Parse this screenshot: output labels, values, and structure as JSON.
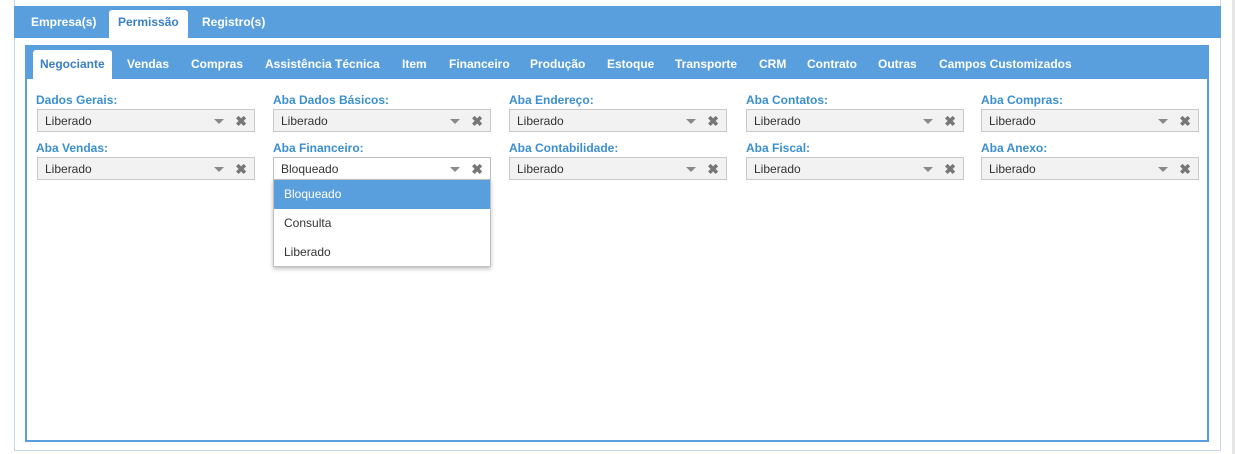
{
  "outer_tabs": [
    "Empresa(s)",
    "Permissão",
    "Registro(s)"
  ],
  "inner_tabs": [
    "Negociante",
    "Vendas",
    "Compras",
    "Assistência Técnica",
    "Item",
    "Financeiro",
    "Produção",
    "Estoque",
    "Transporte",
    "CRM",
    "Contrato",
    "Outras",
    "Campos Customizados"
  ],
  "fields": [
    {
      "label": "Dados Gerais:",
      "value": "Liberado"
    },
    {
      "label": "Aba Dados Básicos:",
      "value": "Liberado"
    },
    {
      "label": "Aba Endereço:",
      "value": "Liberado"
    },
    {
      "label": "Aba Contatos:",
      "value": "Liberado"
    },
    {
      "label": "Aba Compras:",
      "value": "Liberado"
    },
    {
      "label": "Aba Vendas:",
      "value": "Liberado"
    },
    {
      "label": "Aba Financeiro:",
      "value": "Bloqueado"
    },
    {
      "label": "Aba Contabilidade:",
      "value": "Liberado"
    },
    {
      "label": "Aba Fiscal:",
      "value": "Liberado"
    },
    {
      "label": "Aba Anexo:",
      "value": "Liberado"
    }
  ],
  "clear_glyph": "✖",
  "dropdown_options": [
    "Bloqueado",
    "Consulta",
    "Liberado"
  ],
  "colors": {
    "accent": "#5a9fdd",
    "label": "#3a8fd0",
    "active_tab_text": "#3a7fc4"
  }
}
